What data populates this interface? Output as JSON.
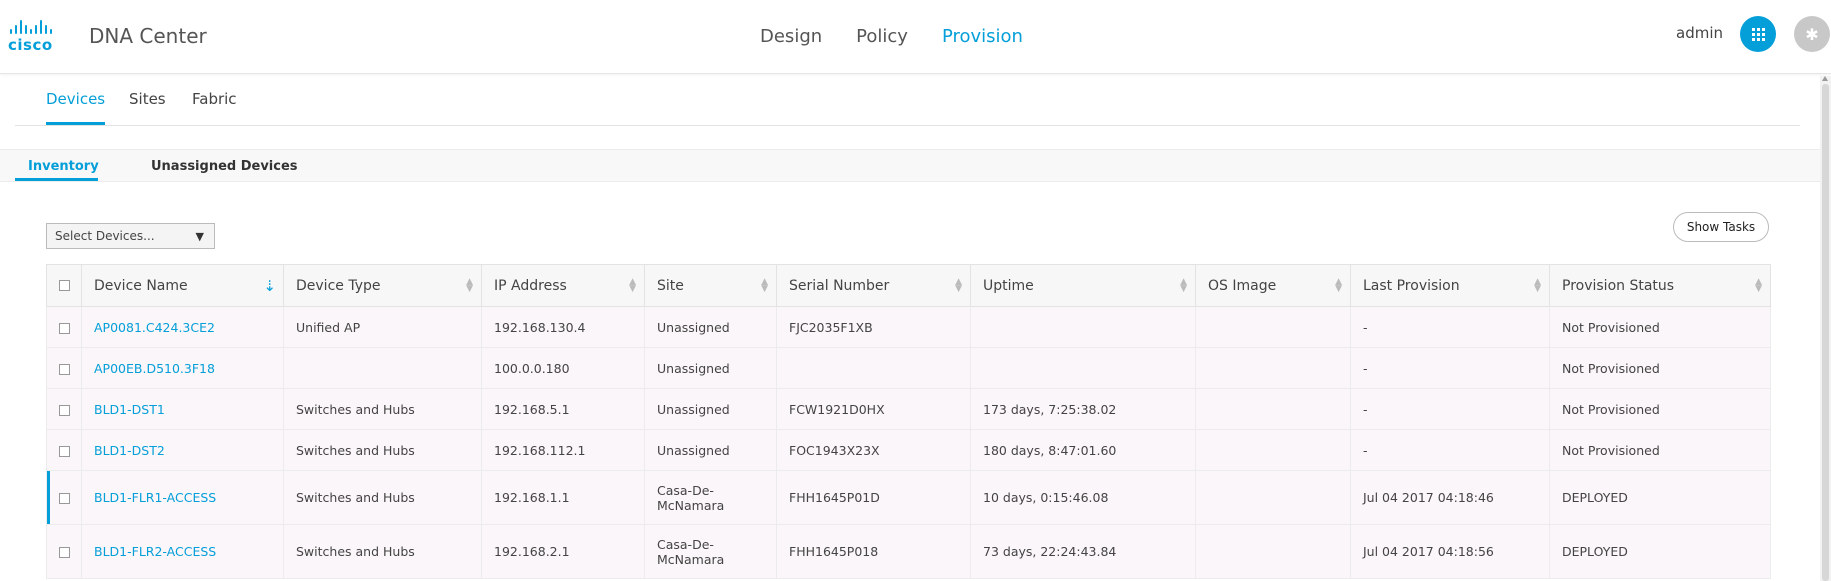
{
  "header": {
    "logo_text": "cisco",
    "app_title": "DNA Center",
    "nav": [
      "Design",
      "Policy",
      "Provision"
    ],
    "active_nav": "Provision",
    "user": "admin"
  },
  "tabs": {
    "primary": [
      "Devices",
      "Sites",
      "Fabric"
    ],
    "secondary": [
      "Inventory",
      "Unassigned Devices"
    ]
  },
  "controls": {
    "select_devices": "Select Devices...",
    "show_tasks": "Show Tasks"
  },
  "table": {
    "columns": [
      "Device Name",
      "Device Type",
      "IP Address",
      "Site",
      "Serial Number",
      "Uptime",
      "OS Image",
      "Last Provision",
      "Provision Status"
    ],
    "rows": [
      {
        "name": "AP0081.C424.3CE2",
        "type": "Unified AP",
        "ip": "192.168.130.4",
        "site": "Unassigned",
        "site2": "",
        "serial": "FJC2035F1XB",
        "uptime": "",
        "os": "",
        "last": "-",
        "status": "Not Provisioned"
      },
      {
        "name": "AP00EB.D510.3F18",
        "type": "",
        "ip": "100.0.0.180",
        "site": "Unassigned",
        "site2": "",
        "serial": "",
        "uptime": "",
        "os": "",
        "last": "-",
        "status": "Not Provisioned"
      },
      {
        "name": "BLD1-DST1",
        "type": "Switches and Hubs",
        "ip": "192.168.5.1",
        "site": "Unassigned",
        "site2": "",
        "serial": "FCW1921D0HX",
        "uptime": "173 days, 7:25:38.02",
        "os": "",
        "last": "-",
        "status": "Not Provisioned"
      },
      {
        "name": "BLD1-DST2",
        "type": "Switches and Hubs",
        "ip": "192.168.112.1",
        "site": "Unassigned",
        "site2": "",
        "serial": "FOC1943X23X",
        "uptime": "180 days, 8:47:01.60",
        "os": "",
        "last": "-",
        "status": "Not Provisioned"
      },
      {
        "name": "BLD1-FLR1-ACCESS",
        "type": "Switches and Hubs",
        "ip": "192.168.1.1",
        "site": "Casa-De-",
        "site2": "McNamara",
        "serial": "FHH1645P01D",
        "uptime": "10 days, 0:15:46.08",
        "os": "",
        "last": "Jul 04 2017 04:18:46",
        "status": "DEPLOYED"
      },
      {
        "name": "BLD1-FLR2-ACCESS",
        "type": "Switches and Hubs",
        "ip": "192.168.2.1",
        "site": "Casa-De-",
        "site2": "McNamara",
        "serial": "FHH1645P018",
        "uptime": "73 days, 22:24:43.84",
        "os": "",
        "last": "Jul 04 2017 04:18:56",
        "status": "DEPLOYED"
      }
    ]
  },
  "colors": {
    "accent": "#049fd9",
    "gear": "#c8c8c8"
  }
}
